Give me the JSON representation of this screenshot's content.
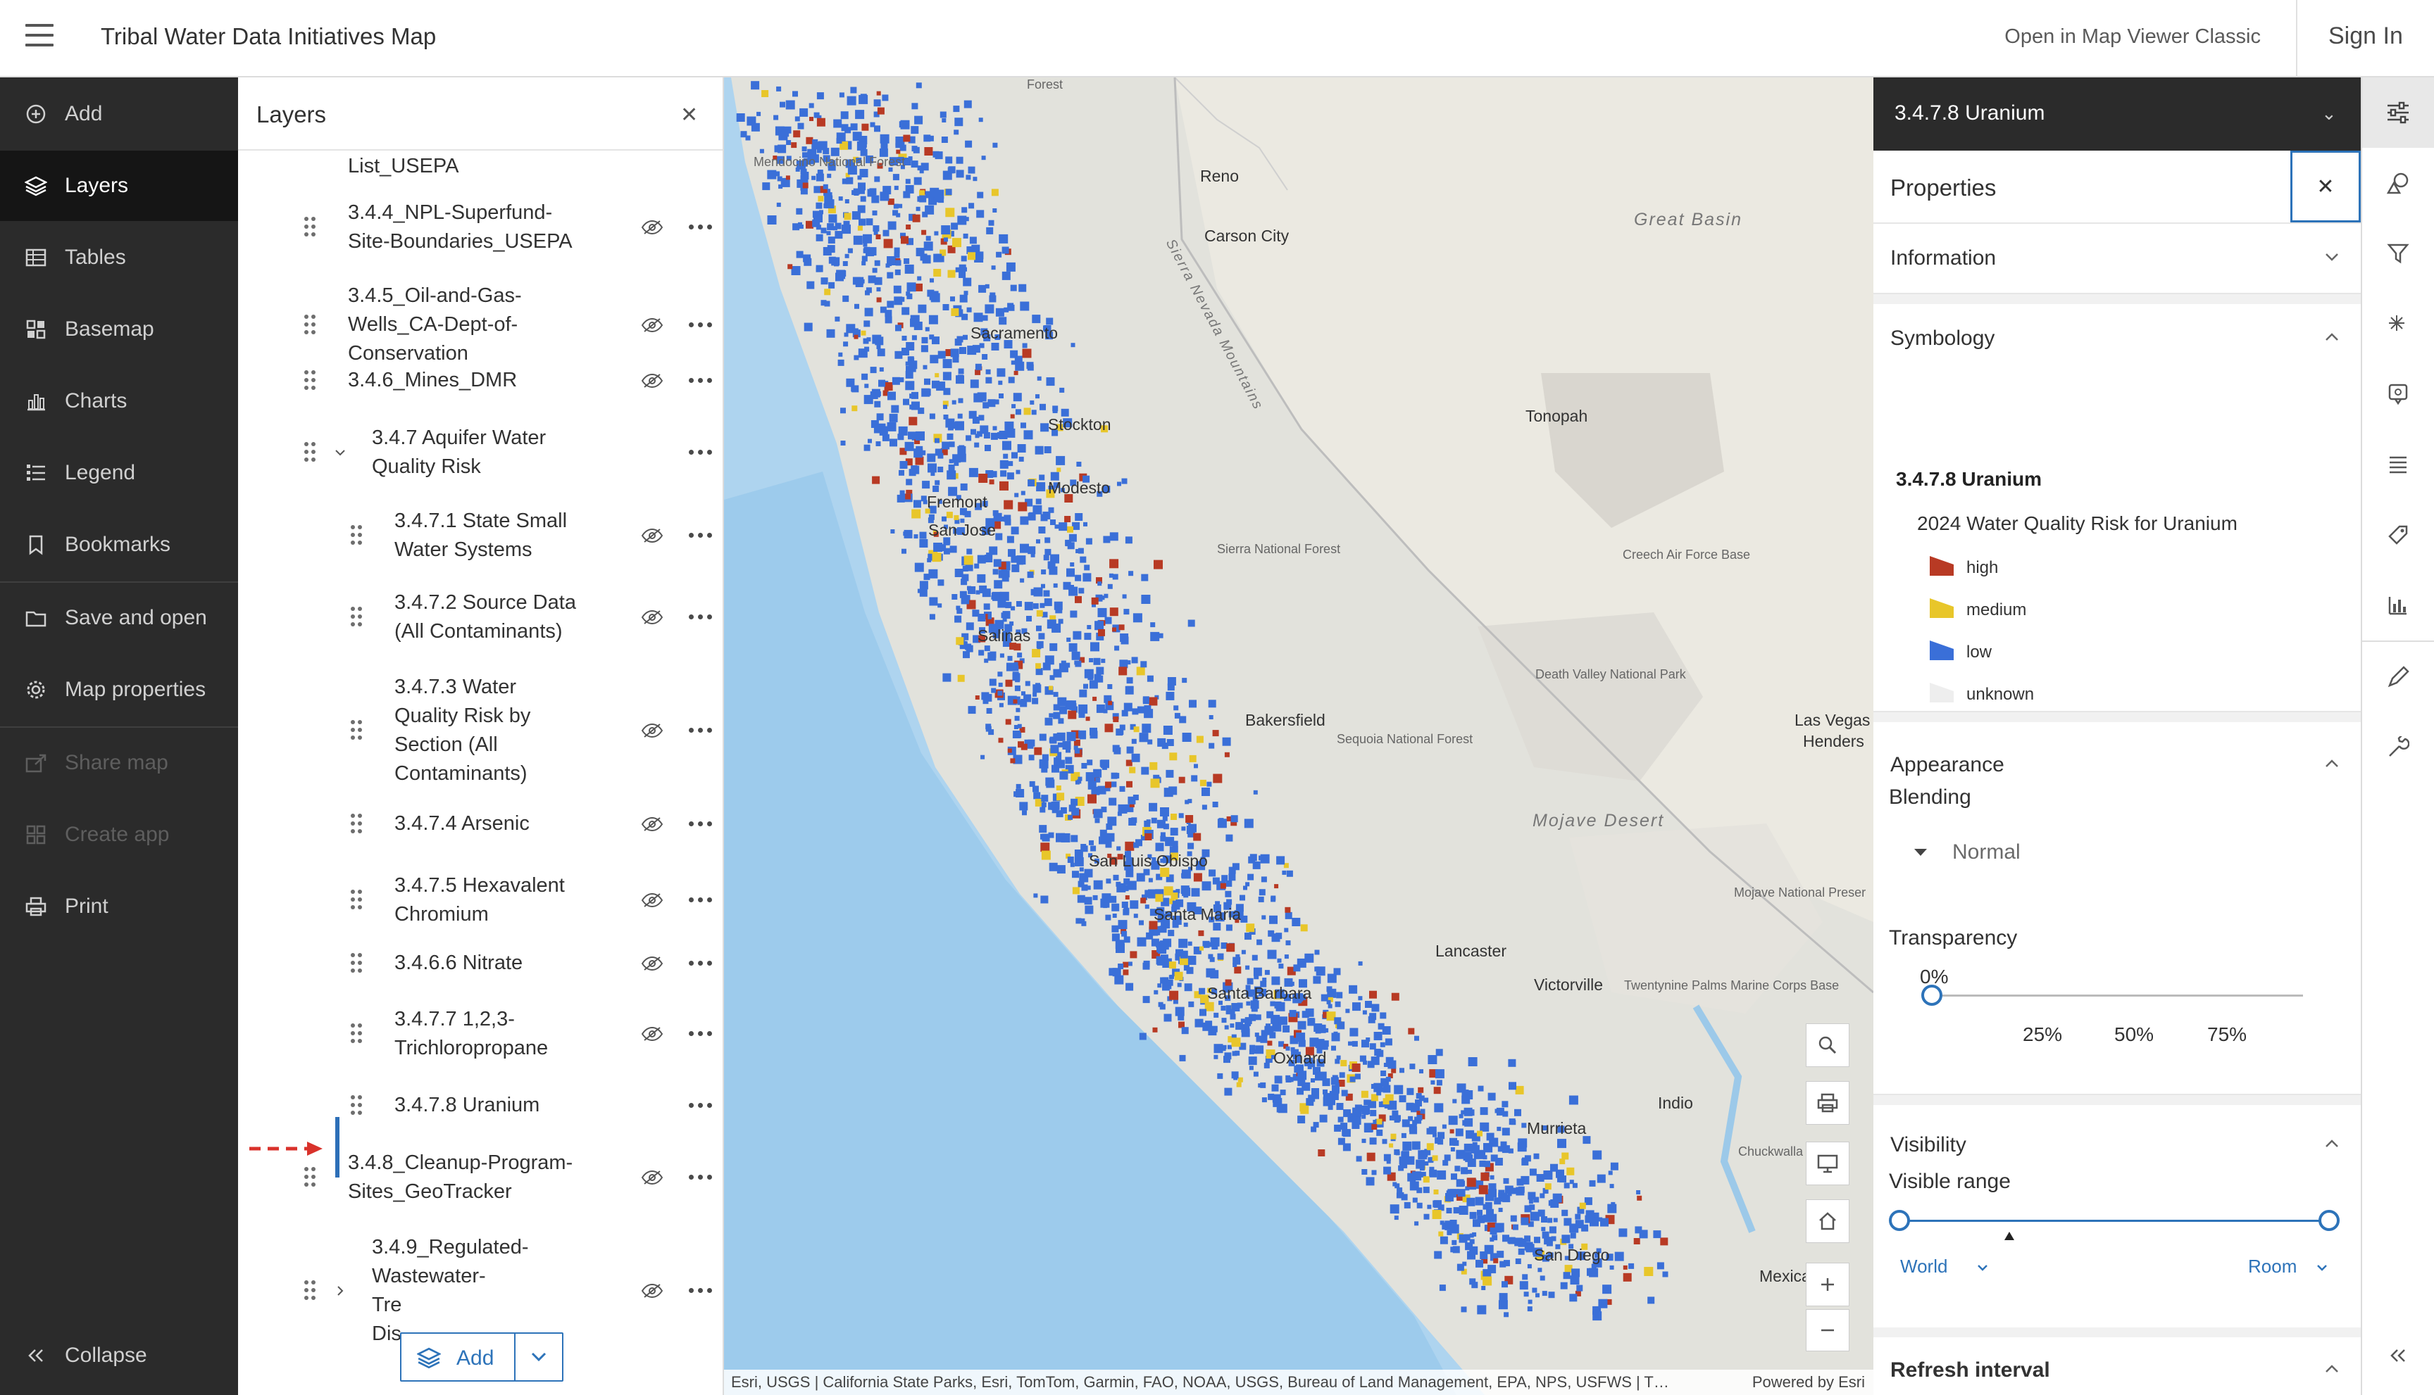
{
  "topbar": {
    "title": "Tribal Water Data Initiatives Map",
    "open_classic": "Open in Map Viewer Classic",
    "sign_in": "Sign In"
  },
  "leftnav": {
    "items": [
      {
        "label": "Add",
        "icon": "plus-circle-icon"
      },
      {
        "label": "Layers",
        "icon": "layers-icon"
      },
      {
        "label": "Tables",
        "icon": "table-icon"
      },
      {
        "label": "Basemap",
        "icon": "basemap-icon"
      },
      {
        "label": "Charts",
        "icon": "chart-icon"
      },
      {
        "label": "Legend",
        "icon": "legend-icon"
      },
      {
        "label": "Bookmarks",
        "icon": "bookmark-icon"
      },
      {
        "label": "Save and open",
        "icon": "folder-icon"
      },
      {
        "label": "Map properties",
        "icon": "gear-icon"
      },
      {
        "label": "Share map",
        "icon": "share-icon"
      },
      {
        "label": "Create app",
        "icon": "apps-icon"
      },
      {
        "label": "Print",
        "icon": "print-icon"
      }
    ],
    "collapse": "Collapse"
  },
  "layers": {
    "title": "Layers",
    "rows": [
      {
        "name": "List_USEPA"
      },
      {
        "name": "3.4.4_NPL-Superfund-\nSite-Boundaries_USEPA"
      },
      {
        "name": "3.4.5_Oil-and-Gas-\nWells_CA-Dept-of-\nConservation"
      },
      {
        "name": "3.4.6_Mines_DMR"
      },
      {
        "name": "3.4.7 Aquifer Water\nQuality Risk"
      },
      {
        "name": "3.4.7.1 State Small\nWater Systems"
      },
      {
        "name": "3.4.7.2 Source Data\n(All Contaminants)"
      },
      {
        "name": "3.4.7.3 Water\nQuality Risk by\nSection (All\nContaminants)"
      },
      {
        "name": "3.4.7.4 Arsenic"
      },
      {
        "name": "3.4.7.5 Hexavalent\nChromium"
      },
      {
        "name": "3.4.6.6 Nitrate"
      },
      {
        "name": "3.4.7.7 1,2,3-\nTrichloropropane"
      },
      {
        "name": "3.4.7.8 Uranium"
      },
      {
        "name": "3.4.8_Cleanup-Program-\nSites_GeoTracker"
      },
      {
        "name": "3.4.9_Regulated-\nWastewater-\nTre\nDis"
      }
    ],
    "add_label": "Add"
  },
  "map": {
    "attribution": "Esri, USGS | California State Parks, Esri, TomTom, Garmin, FAO, NOAA, USGS, Bureau of Land Management, EPA, NPS, USFWS | T…",
    "powered_by": "Powered by Esri",
    "places": [
      "Reno",
      "Carson City",
      "Great Basin",
      "Tonopah",
      "Las Vegas",
      "Henders",
      "San Jose",
      "San Luis Obispo",
      "Santa Maria",
      "Santa Barbara",
      "Mojave Desert",
      "Creech Air Force Base",
      "Death Valley National Park",
      "Mojave National Preser",
      "Twentynine Palms Marine Corps Base",
      "Chuckwalla Mount",
      "Mexica",
      "Mendocino National Forest",
      "Forest",
      "Sierra National Forest",
      "Sequoia National Forest",
      "Sierra Nevada Mountains",
      "Sacramento",
      "Fremont",
      "Modesto",
      "Lancaster",
      "Victorville",
      "Indio",
      "Murrieta",
      "San Diego",
      "Oxnard",
      "Bakersfield",
      "Stockton",
      "Salinas"
    ],
    "colors": {
      "low": "#3a6fd8",
      "medium": "#e8c62a",
      "high": "#b83a24"
    }
  },
  "properties": {
    "layer_header": "3.4.7.8 Uranium",
    "title": "Properties",
    "information": "Information",
    "symbology": "Symbology",
    "sym_layer": "3.4.7.8 Uranium",
    "sym_field": "2024 Water Quality Risk for Uranium",
    "legend": [
      {
        "label": "high",
        "color": "#b83a24"
      },
      {
        "label": "medium",
        "color": "#e8c62a"
      },
      {
        "label": "low",
        "color": "#3a6fd8"
      },
      {
        "label": "unknown",
        "color": "#eeeeee"
      }
    ],
    "appearance": "Appearance",
    "blending": "Blending",
    "blend_mode": "Normal",
    "transparency": "Transparency",
    "transparency_value": "0%",
    "ticks": [
      "25%",
      "50%",
      "75%"
    ],
    "visibility": "Visibility",
    "visible_range": "Visible range",
    "range_min": "World",
    "range_max": "Room",
    "refresh": "Refresh interval"
  }
}
